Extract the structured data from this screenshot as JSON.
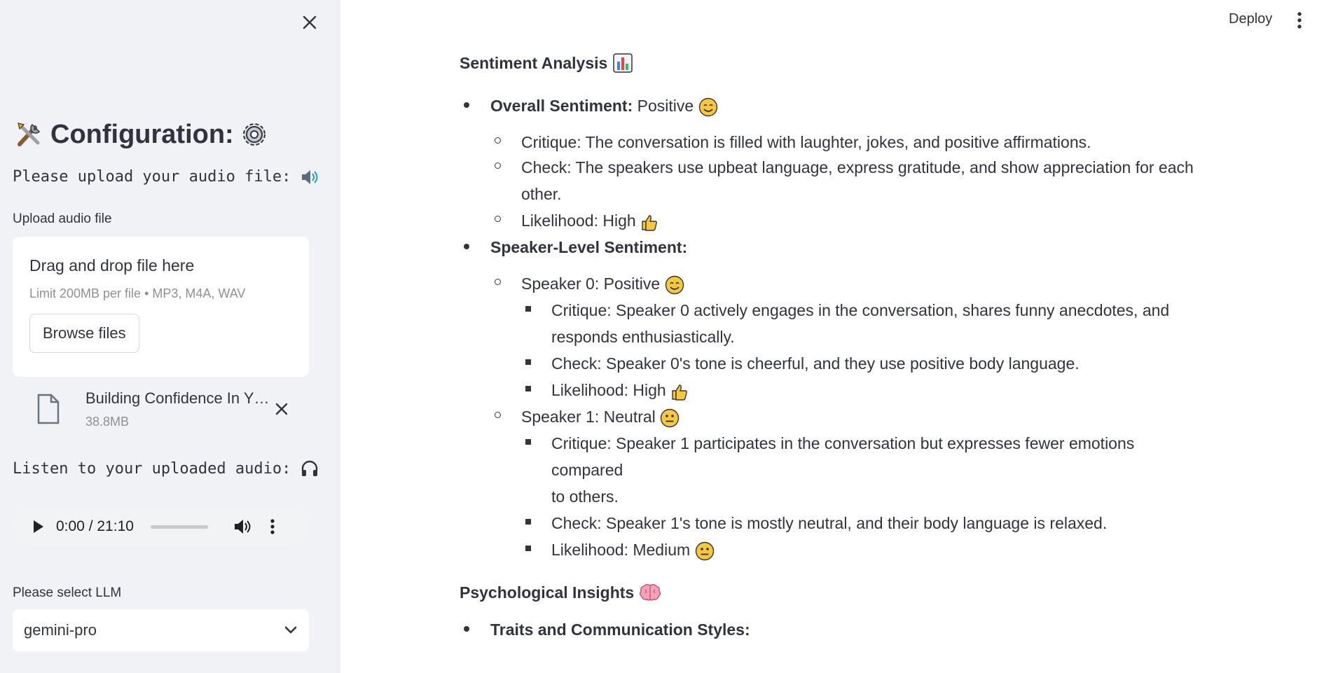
{
  "sidebar": {
    "title": "Configuration:",
    "upload_prompt": "Please upload your audio file:",
    "upload_label": "Upload audio file",
    "dropzone": {
      "title": "Drag and drop file here",
      "subtitle": "Limit 200MB per file • MP3, M4A, WAV",
      "browse_label": "Browse files"
    },
    "file": {
      "name": "Building Confidence In Y…",
      "size": "38.8MB"
    },
    "listen_prompt": "Listen to your uploaded audio:",
    "audio": {
      "time": "0:00 / 21:10"
    },
    "llm_label": "Please select LLM",
    "llm_value": "gemini-pro"
  },
  "header": {
    "deploy_label": "Deploy"
  },
  "main": {
    "sentiment_heading": "Sentiment Analysis",
    "overall": {
      "label": "Overall Sentiment:",
      "value": "Positive",
      "critique": "Critique: The conversation is filled with laughter, jokes, and positive affirmations.",
      "check_line1": "Check: The speakers use upbeat language, express gratitude, and show appreciation for each",
      "check_line2": "other.",
      "likelihood": "Likelihood: High"
    },
    "speaker_level_label": "Speaker-Level Sentiment:",
    "speaker0": {
      "title": "Speaker 0: Positive",
      "critique_line1": "Critique: Speaker 0 actively engages in the conversation, shares funny anecdotes, and",
      "critique_line2": "responds enthusiastically.",
      "check": "Check: Speaker 0's tone is cheerful, and they use positive body language.",
      "likelihood": "Likelihood: High"
    },
    "speaker1": {
      "title": "Speaker 1: Neutral",
      "critique_line1": "Critique: Speaker 1 participates in the conversation but expresses fewer emotions compared",
      "critique_line2": "to others.",
      "check": "Check: Speaker 1's tone is mostly neutral, and their body language is relaxed.",
      "likelihood": "Likelihood: Medium"
    },
    "psych_heading": "Psychological Insights",
    "traits_label": "Traits and Communication Styles:"
  },
  "icons": {
    "title_left": "tools-icon",
    "title_right": "gear-icon",
    "upload": "speaker-icon",
    "listen": "headphones-icon",
    "chart": "bar-chart-icon",
    "positive": "smiling-face-icon",
    "neutral": "neutral-face-icon",
    "like": "thumbs-up-icon",
    "brain": "brain-icon"
  },
  "colors": {
    "sidebar_bg": "#f0f2f6",
    "text": "#31333f",
    "muted": "#8e8f96",
    "emoji_yellow": "#f7c83b",
    "brain_pink": "#f4a3b6"
  }
}
